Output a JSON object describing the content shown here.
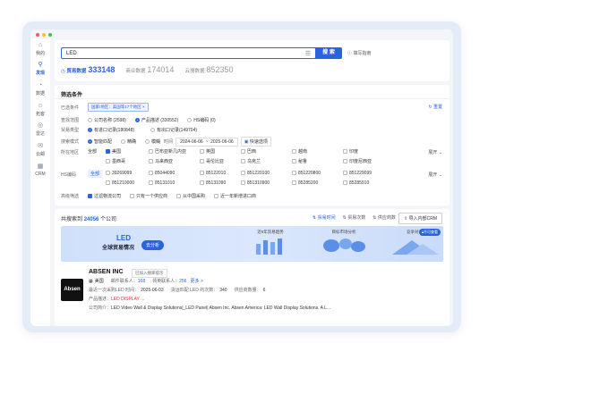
{
  "sidebar": [
    {
      "label": "我的",
      "icon": "home-icon"
    },
    {
      "label": "发现",
      "icon": "discover-icon",
      "active": true
    },
    {
      "label": "数据",
      "icon": "data-icon"
    },
    {
      "label": "拓客",
      "icon": "customer-icon"
    },
    {
      "label": "雷达",
      "icon": "radar-icon"
    },
    {
      "label": "云邮",
      "icon": "mail-icon"
    },
    {
      "label": "CRM",
      "icon": "crm-icon"
    }
  ],
  "search": {
    "value": "LED",
    "button": "搜 索",
    "hint": "填写指南"
  },
  "tabs": [
    {
      "label": "贸易数据",
      "count": "333148",
      "active": true
    },
    {
      "label": "商业数据",
      "count": "174014"
    },
    {
      "label": "云搜数据",
      "count": "852350"
    }
  ],
  "filter": {
    "title": "筛选条件",
    "selected_label": "已选条件",
    "selected_tag": "国家/地区：美国等17个地区",
    "reset": "重置",
    "scope_label": "查找范围",
    "scope_options": [
      "公司名称 (2598)",
      "产品描述 (330552)",
      "HS编码 (0)"
    ],
    "type_label": "贸易类型",
    "type_options": [
      "有进口记录(180848)",
      "有出口记录(149704)"
    ],
    "mode_label": "搜索模式",
    "mode_options": [
      "智能匹配",
      "精确",
      "模糊"
    ],
    "time_label": "时间",
    "date_start": "2024-06-06",
    "date_to": "~",
    "date_end": "2025-06-06",
    "quick": "快速选项",
    "region_label": "所在地区",
    "regions_row1": [
      "全部",
      "美国",
      "巴布亚新几内亚",
      "英国",
      "巴西",
      "越南",
      "印度"
    ],
    "regions_row2": [
      "墨西哥",
      "马来西亚",
      "哥伦比亚",
      "乌克兰",
      "秘鲁",
      "印度尼西亚"
    ],
    "expand": "展开",
    "hs_label": "HS编码",
    "hs_all": "全部",
    "hs_row1": [
      "39269099",
      "85044090",
      "85122010",
      "851220100",
      "851220800",
      "851229099"
    ],
    "hs_row2": [
      "851210000",
      "85131010",
      "85131090",
      "851310900",
      "85285200",
      "85285910"
    ],
    "adv_label": "高级筛选",
    "adv_options": [
      "过滤物流公司",
      "只有一个供应商",
      "从中国采购",
      "近一年新增进口商"
    ]
  },
  "results": {
    "prefix": "共搜索到",
    "count": "24056",
    "suffix": "个公司",
    "sorts": [
      "贸易时间",
      "贸易次数",
      "供应商数"
    ],
    "export": "导入内部CRM"
  },
  "banner": {
    "title": "LED",
    "subtitle": "全球贸易情况",
    "button": "去分析",
    "panels": [
      "近5年贸易趋势",
      "目标市场分析",
      "竞争对手"
    ],
    "badge": "不可查看"
  },
  "company": {
    "logo": "Absen",
    "name": "ABSEN INC",
    "status": "已加入搜库提示",
    "country": "美国",
    "email_label": "邮件联系人：",
    "email_count": "168",
    "contact_label": "领英联系人：",
    "contact_count": "256",
    "more": "更多 >",
    "last_label": "最近一次采购LED 时间：",
    "last_date": "2025-06-03",
    "match_label": "货运匹配 LED 的次数：",
    "match_count": "340",
    "supplier_label": "供应商数量：",
    "supplier_count": "6",
    "product_label": "产品描述：",
    "product": "LED DISPLAY ...",
    "intro_label": "公司简介：",
    "intro": "LED Video Wall & Display Solutions|_LED Panel| Absen Inc. Absen America: LED Wall Display Solutions. A L..."
  },
  "colors": {
    "accent": "#2b62e0",
    "red": "#e03131"
  }
}
